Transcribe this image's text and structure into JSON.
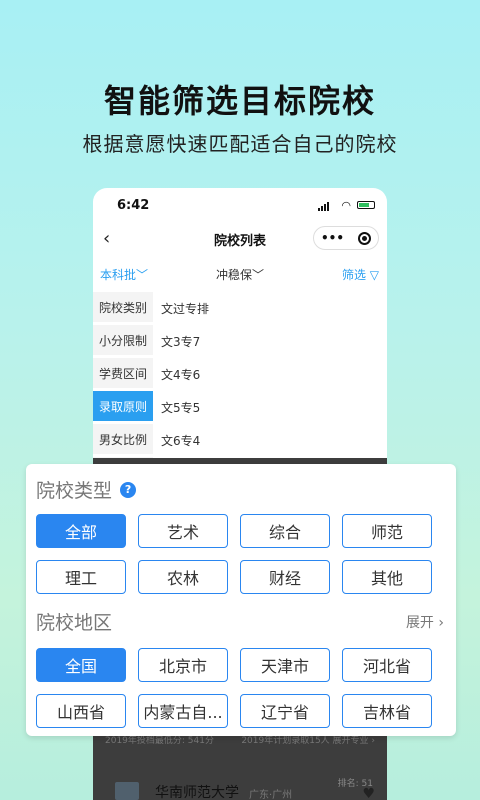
{
  "hero": {
    "title": "智能筛选目标院校",
    "subtitle": "根据意愿快速匹配适合自己的院校"
  },
  "phone": {
    "status": {
      "time": "6:42"
    },
    "nav": {
      "back": "‹",
      "title": "院校列表",
      "more": "•••"
    },
    "filters": {
      "batch": "本科批﹀",
      "mode": "冲稳保﹀",
      "screen": "筛选 ▽"
    },
    "side_menu": [
      {
        "label": "院校类别",
        "active": false
      },
      {
        "label": "小分限制",
        "active": false
      },
      {
        "label": "学费区间",
        "active": false
      },
      {
        "label": "录取原则",
        "active": true
      },
      {
        "label": "男女比例",
        "active": false
      }
    ],
    "options": [
      "文过专排",
      "文3专7",
      "文4专6",
      "文5专5",
      "文6专4"
    ],
    "background_list": {
      "line_left": "2019年投档最低分: 541分",
      "line_right": "2019年计划录取15人  展开专业 ›",
      "rank": "排名: 51",
      "name": "华南师范大学",
      "location": "广东·广州"
    }
  },
  "sheet": {
    "type_title": "院校类型",
    "help": "?",
    "types": [
      {
        "label": "全部",
        "selected": true
      },
      {
        "label": "艺术",
        "selected": false
      },
      {
        "label": "综合",
        "selected": false
      },
      {
        "label": "师范",
        "selected": false
      },
      {
        "label": "理工",
        "selected": false
      },
      {
        "label": "农林",
        "selected": false
      },
      {
        "label": "财经",
        "selected": false
      },
      {
        "label": "其他",
        "selected": false
      }
    ],
    "region_title": "院校地区",
    "expand": "展开 ›",
    "regions": [
      {
        "label": "全国",
        "selected": true
      },
      {
        "label": "北京市",
        "selected": false
      },
      {
        "label": "天津市",
        "selected": false
      },
      {
        "label": "河北省",
        "selected": false
      },
      {
        "label": "山西省",
        "selected": false
      },
      {
        "label": "内蒙古自...",
        "selected": false
      },
      {
        "label": "辽宁省",
        "selected": false
      },
      {
        "label": "吉林省",
        "selected": false
      }
    ]
  },
  "colors": {
    "accent": "#2a86f0",
    "link": "#2a9ff0"
  }
}
